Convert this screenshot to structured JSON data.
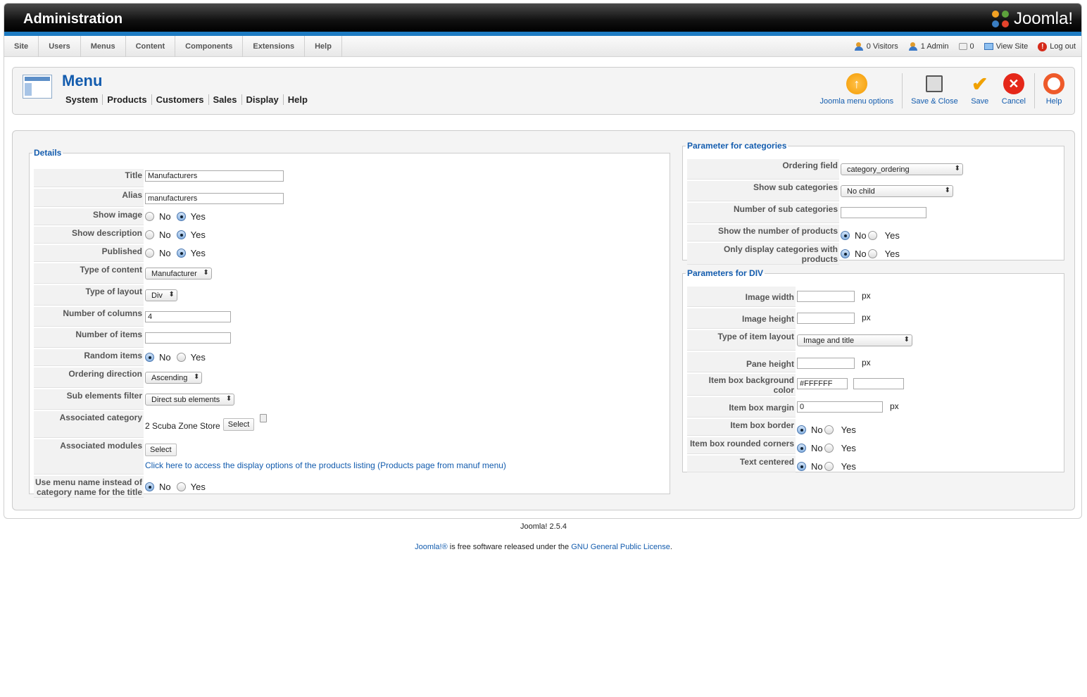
{
  "header": {
    "title": "Administration",
    "logo_text": "Joomla!"
  },
  "topmenu": {
    "items": [
      "Site",
      "Users",
      "Menus",
      "Content",
      "Components",
      "Extensions",
      "Help"
    ]
  },
  "status": {
    "visitors": "0 Visitors",
    "admins": "1 Admin",
    "messages": "0",
    "view_site": "View Site",
    "logout": "Log out"
  },
  "page": {
    "title": "Menu",
    "submenu": [
      "System",
      "Products",
      "Customers",
      "Sales",
      "Display",
      "Help"
    ]
  },
  "toolbar": {
    "options": "Joomla menu options",
    "save_close": "Save & Close",
    "save": "Save",
    "cancel": "Cancel",
    "help": "Help"
  },
  "details": {
    "legend": "Details",
    "title_label": "Title",
    "title_value": "Manufacturers",
    "alias_label": "Alias",
    "alias_value": "manufacturers",
    "show_image_label": "Show image",
    "show_desc_label": "Show description",
    "published_label": "Published",
    "type_content_label": "Type of content",
    "type_content_value": "Manufacturer",
    "type_layout_label": "Type of layout",
    "type_layout_value": "Div",
    "num_columns_label": "Number of columns",
    "num_columns_value": "4",
    "num_items_label": "Number of items",
    "num_items_value": "",
    "random_label": "Random items",
    "ordering_label": "Ordering direction",
    "ordering_value": "Ascending",
    "sub_filter_label": "Sub elements filter",
    "sub_filter_value": "Direct sub elements",
    "assoc_cat_label": "Associated category",
    "assoc_cat_value": "2 Scuba Zone Store",
    "assoc_mod_label": "Associated modules",
    "select_btn": "Select",
    "display_link": "Click here to access the display options of the products listing (Products page from manuf menu)",
    "use_menu_name_label": "Use menu name instead of category name for the title",
    "no": "No",
    "yes": "Yes"
  },
  "categories": {
    "legend": "Parameter for categories",
    "ordering_label": "Ordering field",
    "ordering_value": "category_ordering",
    "show_sub_label": "Show sub categories",
    "show_sub_value": "No child",
    "num_sub_label": "Number of sub categories",
    "num_sub_value": "",
    "show_num_prod_label": "Show the number of products",
    "only_display_label": "Only display categories with products"
  },
  "div_params": {
    "legend": "Parameters for DIV",
    "img_width_label": "Image width",
    "img_height_label": "Image height",
    "item_layout_label": "Type of item layout",
    "item_layout_value": "Image and title",
    "pane_height_label": "Pane height",
    "box_bg_label": "Item box background color",
    "box_bg_value": "#FFFFFF",
    "box_margin_label": "Item box margin",
    "box_margin_value": "0",
    "box_border_label": "Item box border",
    "rounded_label": "Item box rounded corners",
    "centered_label": "Text centered",
    "px": "px"
  },
  "footer": {
    "version": "Joomla! 2.5.4",
    "joomla_link": "Joomla!®",
    "middle": " is free software released under the ",
    "license_link": "GNU General Public License",
    "end": "."
  },
  "colors": {
    "accent": "#135cae",
    "header_bar": "#1d7bc2"
  }
}
